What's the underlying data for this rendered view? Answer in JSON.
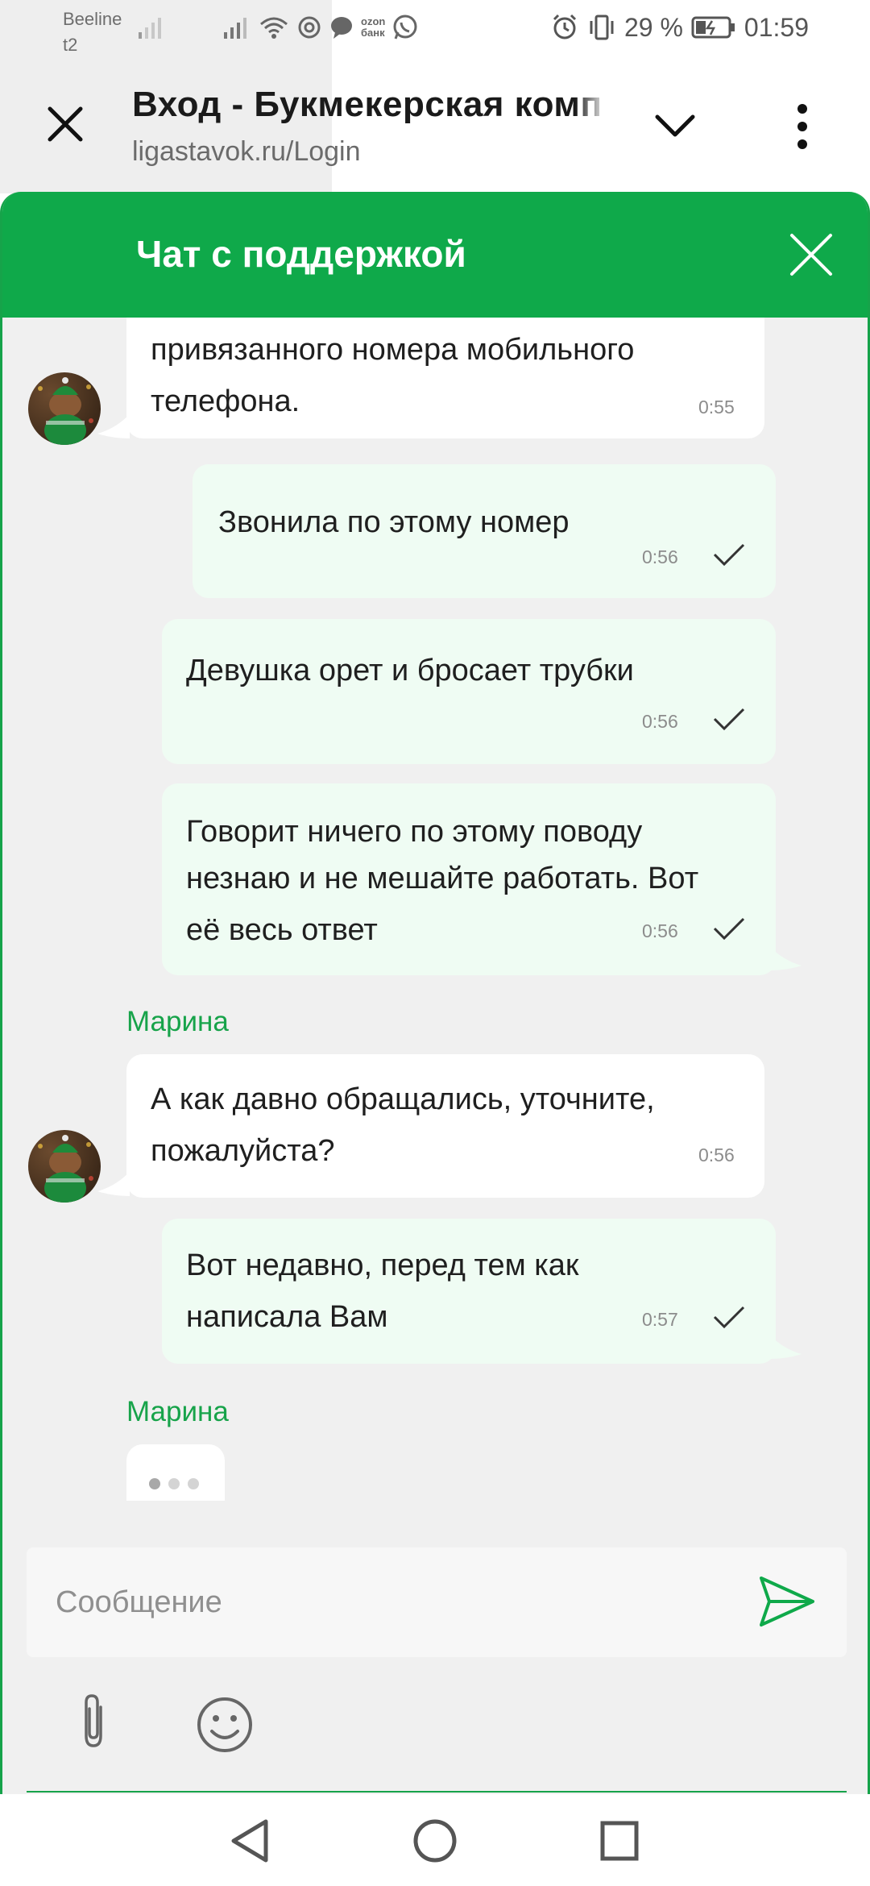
{
  "status_bar": {
    "carrier_1": "Beeline",
    "carrier_2": "t2",
    "ozon_line1": "ozon",
    "ozon_line2": "банк",
    "battery": "29 %",
    "time": "01:59"
  },
  "browser": {
    "page_title": "Вход - Букмекерская комп",
    "url": "ligastavok.ru/Login"
  },
  "chat": {
    "header_title": "Чат с поддержкой",
    "agent_name": "Марина",
    "messages": [
      {
        "direction": "in",
        "text_line1": "привязанного номера мобильного",
        "text_line2": "телефона.",
        "time": "0:55"
      },
      {
        "direction": "out",
        "text_line1": "Звонила по этому номер",
        "time": "0:56"
      },
      {
        "direction": "out",
        "text_line1": "Девушка орет и бросает трубки",
        "time": "0:56"
      },
      {
        "direction": "out",
        "text_line1": "Говорит ничего по этому поводу",
        "text_line2": "незнаю и не мешайте работать. Вот",
        "text_line3": "её весь ответ",
        "time": "0:56"
      },
      {
        "direction": "in",
        "text_line1": "А как давно обращались, уточните,",
        "text_line2": "пожалуйста?",
        "time": "0:56"
      },
      {
        "direction": "out",
        "text_line1": "Вот недавно, перед тем как",
        "text_line2": "написала Вам",
        "time": "0:57"
      }
    ],
    "input_placeholder": "Сообщение"
  },
  "colors": {
    "brand_green": "#0fa94a",
    "outgoing_bubble": "#effcf3",
    "incoming_bubble": "#ffffff",
    "chat_background": "#f0f0f0"
  },
  "icons": [
    "close-icon",
    "chevron-down-icon",
    "more-vert-icon",
    "close-chat-icon",
    "check-icon",
    "send-icon",
    "attach-icon",
    "emoji-icon",
    "nav-back-icon",
    "nav-home-icon",
    "nav-recent-icon"
  ]
}
